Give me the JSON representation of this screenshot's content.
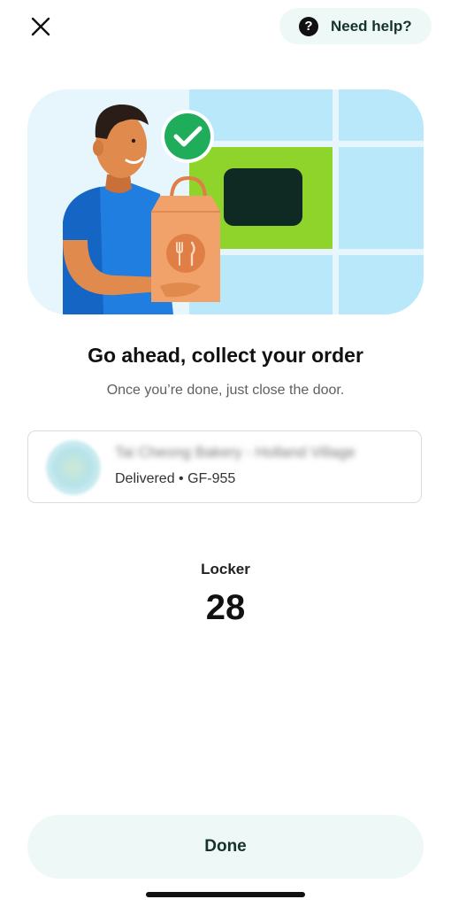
{
  "header": {
    "close_icon": "close-icon",
    "help_label": "Need help?",
    "help_icon": "question-circle-icon"
  },
  "hero": {
    "illustration": "person-holding-food-bag-at-locker",
    "check_icon": "checkmark-icon",
    "colors": {
      "sky": "#b9e8fb",
      "locker": "#8fd42a",
      "check": "#1fad5c",
      "shirt": "#1f7ee0",
      "bag": "#f1a26a"
    }
  },
  "main": {
    "title": "Go ahead, collect your order",
    "subtitle": "Once you’re done, just close the door."
  },
  "order": {
    "store_name": "Tai Cheong Bakery - Holland Village",
    "status": "Delivered • GF-955"
  },
  "locker": {
    "label": "Locker",
    "number": "28"
  },
  "footer": {
    "done_label": "Done"
  }
}
